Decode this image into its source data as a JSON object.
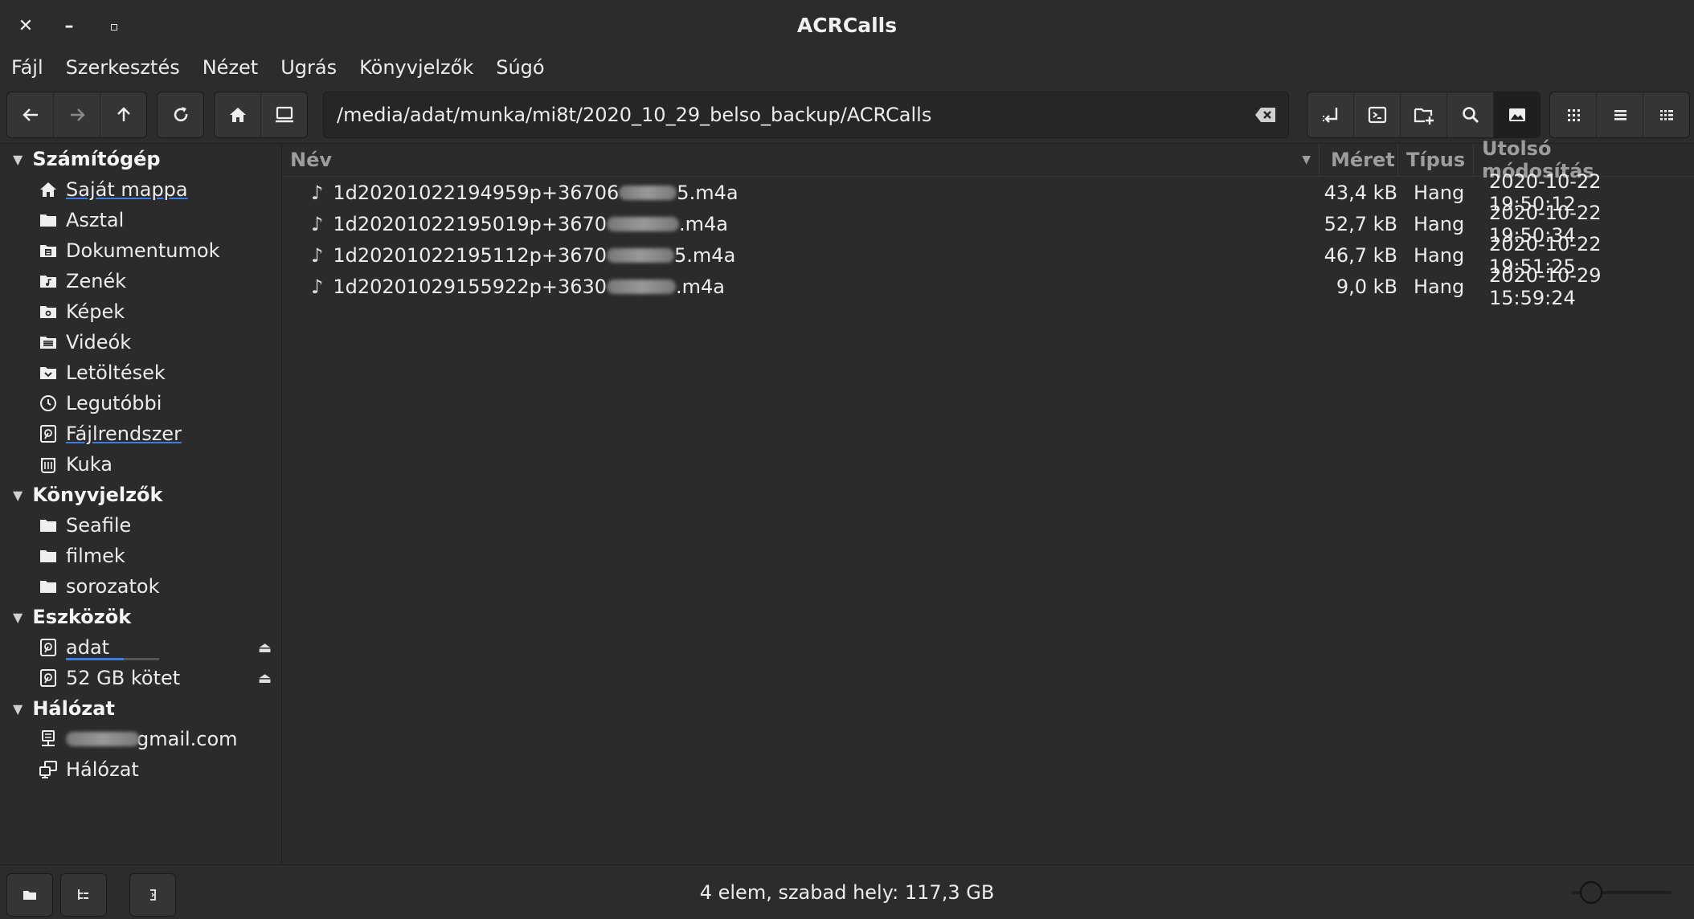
{
  "window": {
    "title": "ACRCalls",
    "close": "✕",
    "minimize": "–",
    "maximize": "▫"
  },
  "menu": [
    "Fájl",
    "Szerkesztés",
    "Nézet",
    "Ugrás",
    "Könyvjelzők",
    "Súgó"
  ],
  "toolbar": {
    "nav_icons": [
      "back-icon",
      "forward-icon",
      "up-icon"
    ],
    "reload_icon": "reload-icon",
    "place_icons": [
      "home-icon",
      "computer-icon"
    ],
    "path": "/media/adat/munka/mi8t/2020_10_29_belso_backup/ACRCalls",
    "tool_icons": [
      "open-icon",
      "terminal-icon",
      "new-folder-icon",
      "search-icon",
      "image-preview-icon"
    ],
    "view_icons": [
      "icon-view-icon",
      "list-view-icon",
      "compact-view-icon"
    ],
    "active_tool": "image-preview-icon",
    "active_view": "list-view-icon"
  },
  "sidebar": {
    "sections": [
      {
        "title": "Számítógép",
        "items": [
          {
            "label": "Saját mappa",
            "icon": "home-icon"
          },
          {
            "label": "Asztal",
            "icon": "folder-icon"
          },
          {
            "label": "Dokumentumok",
            "icon": "documents-icon"
          },
          {
            "label": "Zenék",
            "icon": "music-folder-icon"
          },
          {
            "label": "Képek",
            "icon": "pictures-folder-icon"
          },
          {
            "label": "Videók",
            "icon": "videos-folder-icon"
          },
          {
            "label": "Letöltések",
            "icon": "downloads-folder-icon"
          },
          {
            "label": "Legutóbbi",
            "icon": "clock-icon"
          },
          {
            "label": "Fájlrendszer",
            "icon": "drive-icon"
          },
          {
            "label": "Kuka",
            "icon": "trash-icon"
          }
        ]
      },
      {
        "title": "Könyvjelzők",
        "items": [
          {
            "label": "Seafile",
            "icon": "folder-icon"
          },
          {
            "label": "filmek",
            "icon": "folder-icon"
          },
          {
            "label": "sorozatok",
            "icon": "folder-icon"
          }
        ]
      },
      {
        "title": "Eszközök",
        "items": [
          {
            "label": "adat",
            "icon": "drive-icon",
            "eject": "⏏",
            "usage": 0.62
          },
          {
            "label": "52 GB kötet",
            "icon": "drive-icon",
            "eject": "⏏"
          }
        ]
      },
      {
        "title": "Hálózat",
        "items": [
          {
            "label": "gmail.com",
            "icon": "network-server-icon",
            "redacted": true
          },
          {
            "label": "Hálózat",
            "icon": "network-icon"
          }
        ]
      }
    ]
  },
  "columns": {
    "name": "Név",
    "size": "Méret",
    "type": "Típus",
    "modified": "Utolsó módosítás"
  },
  "files": [
    {
      "name_prefix": "1d20201022194959p+36706",
      "name_suffix": "5.m4a",
      "size": "43,4 kB",
      "type": "Hang",
      "modified": "2020-10-22 19:50:12"
    },
    {
      "name_prefix": "1d20201022195019p+3670",
      "name_suffix": ".m4a",
      "size": "52,7 kB",
      "type": "Hang",
      "modified": "2020-10-22 19:50:34"
    },
    {
      "name_prefix": "1d20201022195112p+3670",
      "name_suffix": "5.m4a",
      "size": "46,7 kB",
      "type": "Hang",
      "modified": "2020-10-22 19:51:25"
    },
    {
      "name_prefix": "1d20201029155922p+3630",
      "name_suffix": ".m4a",
      "size": "9,0 kB",
      "type": "Hang",
      "modified": "2020-10-29 15:59:24"
    }
  ],
  "status": {
    "text": "4 elem, szabad hely: 117,3 GB",
    "zoom_level": 0.1
  },
  "colors": {
    "background": "#2b2b2b",
    "accent": "#3d7ce0"
  }
}
